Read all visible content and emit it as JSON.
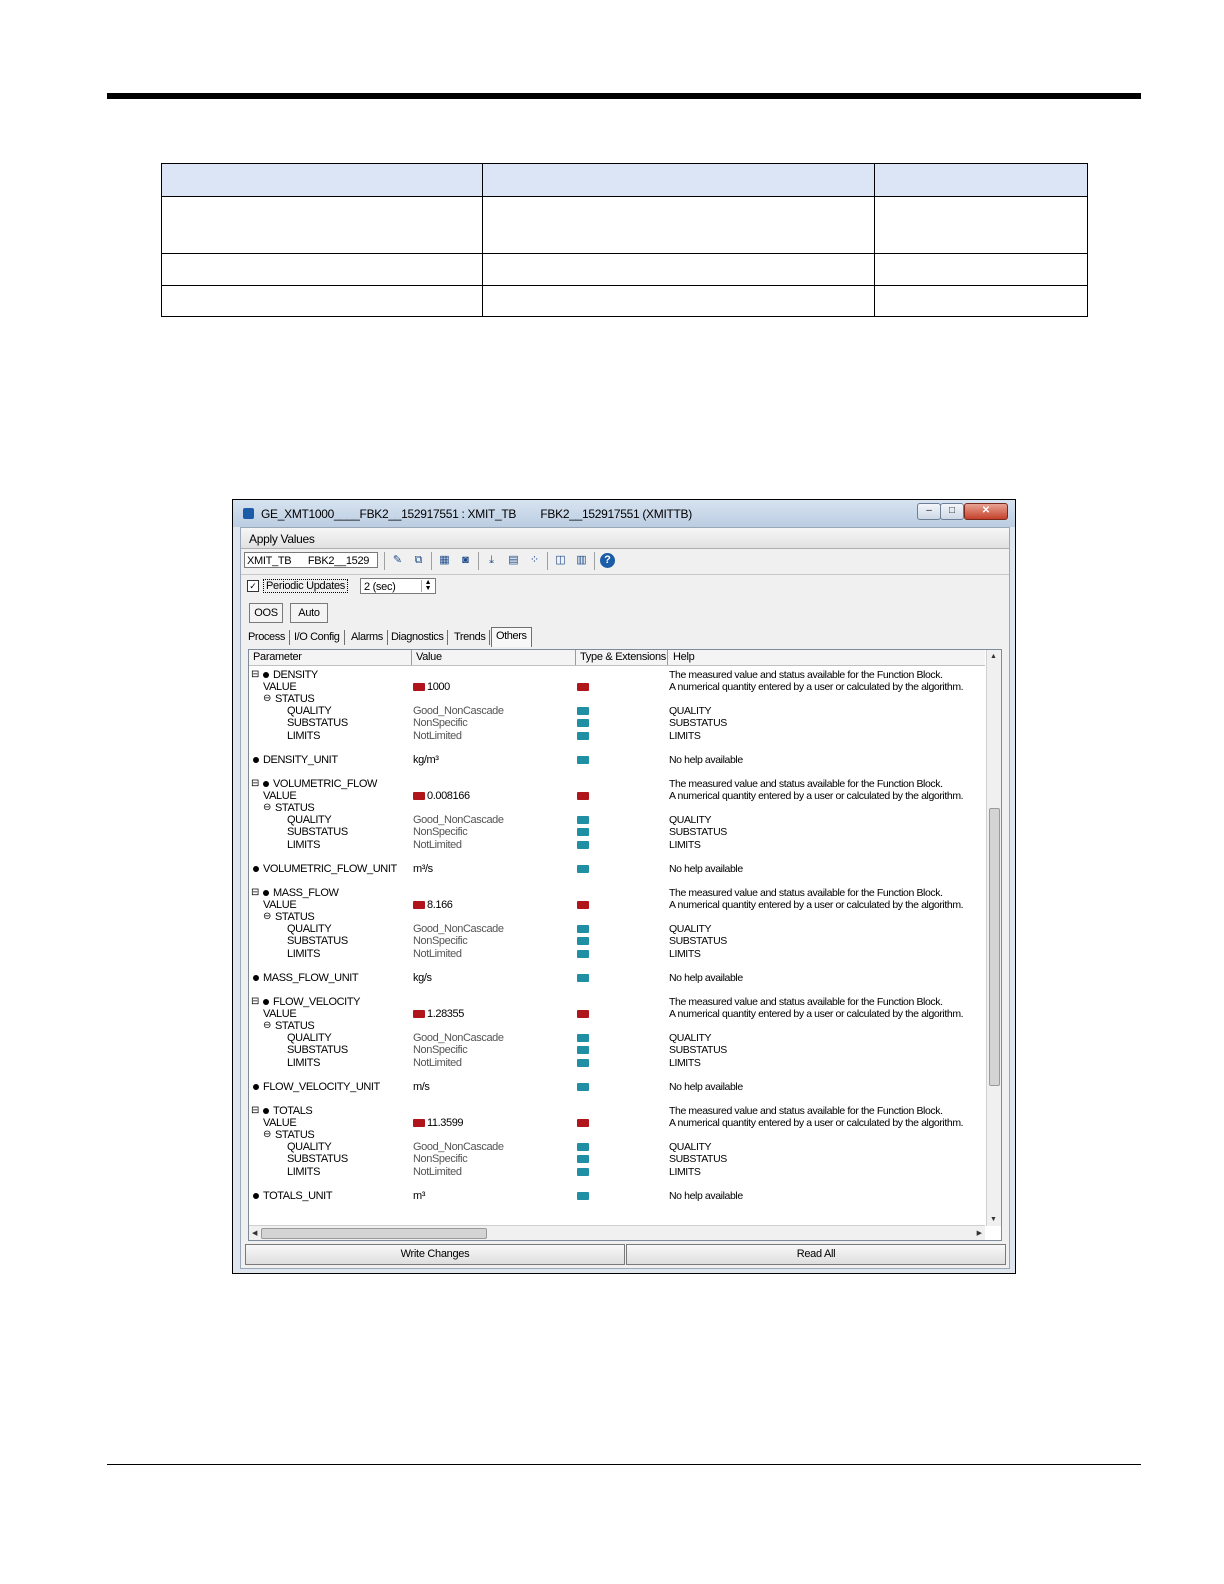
{
  "window": {
    "title": "GE_XMT1000____FBK2__152917551 : XMIT_TB        FBK2__152917551 (XMITTB)",
    "apply_values": "Apply Values",
    "tag": "XMIT_TB      FBK2__1529",
    "periodic_updates_label": "Periodic Updates",
    "interval": "2 (sec)",
    "mode_oos": "OOS",
    "mode_auto": "Auto",
    "tabs": [
      "Process",
      "I/O Config",
      "Alarms",
      "Diagnostics",
      "Trends",
      "Others"
    ],
    "active_tab": "Others",
    "columns": {
      "parameter": "Parameter",
      "value": "Value",
      "type": "Type & Extensions",
      "help": "Help"
    },
    "write_changes": "Write Changes",
    "read_all": "Read All"
  },
  "groups": [
    {
      "name": "DENSITY",
      "value": "1000",
      "quality": "Good_NonCascade",
      "substatus": "NonSpecific",
      "limits": "NotLimited",
      "unit_name": "DENSITY_UNIT",
      "unit_value": "kg/m³"
    },
    {
      "name": "VOLUMETRIC_FLOW",
      "value": "0.008166",
      "quality": "Good_NonCascade",
      "substatus": "NonSpecific",
      "limits": "NotLimited",
      "unit_name": "VOLUMETRIC_FLOW_UNIT",
      "unit_value": "m³/s"
    },
    {
      "name": "MASS_FLOW",
      "value": "8.166",
      "quality": "Good_NonCascade",
      "substatus": "NonSpecific",
      "limits": "NotLimited",
      "unit_name": "MASS_FLOW_UNIT",
      "unit_value": "kg/s"
    },
    {
      "name": "FLOW_VELOCITY",
      "value": "1.28355",
      "quality": "Good_NonCascade",
      "substatus": "NonSpecific",
      "limits": "NotLimited",
      "unit_name": "FLOW_VELOCITY_UNIT",
      "unit_value": "m/s"
    },
    {
      "name": "TOTALS",
      "value": "11.3599",
      "quality": "Good_NonCascade",
      "substatus": "NonSpecific",
      "limits": "NotLimited",
      "unit_name": "TOTALS_UNIT",
      "unit_value": "m³"
    }
  ],
  "labels": {
    "value": "VALUE",
    "status": "STATUS",
    "quality": "QUALITY",
    "substatus": "SUBSTATUS",
    "limits": "LIMITS"
  },
  "help": {
    "group": "The measured value and status available for the Function Block.",
    "value": "A numerical quantity entered by a user or calculated by the algorithm.",
    "quality": "QUALITY",
    "substatus": "SUBSTATUS",
    "limits": "LIMITS",
    "none": "No help available"
  },
  "colors": {
    "table_header": "#dbe5f5",
    "value_icon": "#b0151c",
    "status_icon": "#1f8fa4"
  }
}
